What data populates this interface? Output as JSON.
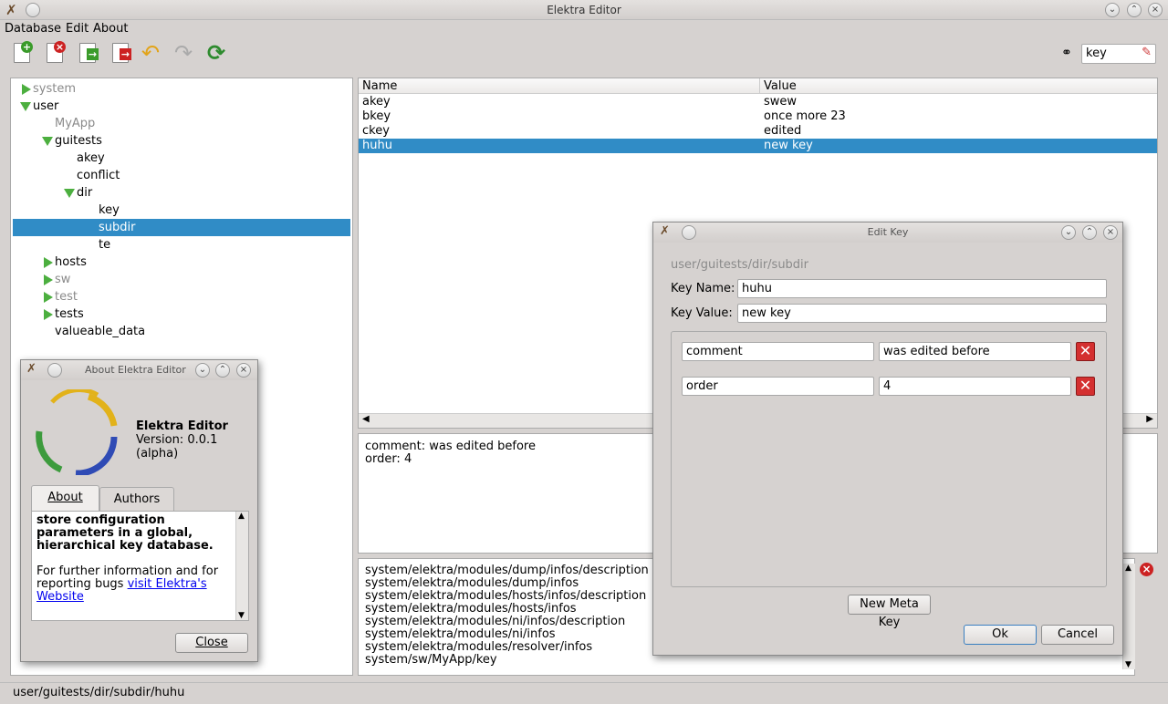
{
  "window": {
    "title": "Elektra Editor"
  },
  "menu": {
    "items": [
      "Database",
      "Edit",
      "About"
    ]
  },
  "search": {
    "value": "key"
  },
  "tree": {
    "items": [
      {
        "label": "system",
        "gray": true,
        "arrow": "right",
        "indent": 0
      },
      {
        "label": "user",
        "gray": false,
        "arrow": "down",
        "indent": 0
      },
      {
        "label": "MyApp",
        "gray": true,
        "arrow": "none",
        "indent": 1
      },
      {
        "label": "guitests",
        "gray": false,
        "arrow": "down",
        "indent": 1
      },
      {
        "label": "akey",
        "gray": false,
        "arrow": "none",
        "indent": 2
      },
      {
        "label": "conflict",
        "gray": false,
        "arrow": "none",
        "indent": 2
      },
      {
        "label": "dir",
        "gray": false,
        "arrow": "down",
        "indent": 2
      },
      {
        "label": "key",
        "gray": false,
        "arrow": "none",
        "indent": 3
      },
      {
        "label": "subdir",
        "gray": false,
        "arrow": "none",
        "indent": 3,
        "selected": true
      },
      {
        "label": "te",
        "gray": false,
        "arrow": "none",
        "indent": 3
      },
      {
        "label": "hosts",
        "gray": false,
        "arrow": "right",
        "indent": 1
      },
      {
        "label": "sw",
        "gray": true,
        "arrow": "right",
        "indent": 1
      },
      {
        "label": "test",
        "gray": true,
        "arrow": "right",
        "indent": 1
      },
      {
        "label": "tests",
        "gray": false,
        "arrow": "right",
        "indent": 1
      },
      {
        "label": "valueable_data",
        "gray": false,
        "arrow": "none",
        "indent": 1
      }
    ]
  },
  "table": {
    "headers": [
      "Name",
      "Value"
    ],
    "rows": [
      {
        "name": "akey",
        "value": "swew"
      },
      {
        "name": "bkey",
        "value": "once more 23"
      },
      {
        "name": "ckey",
        "value": "edited"
      },
      {
        "name": "huhu",
        "value": "new key",
        "selected": true
      }
    ]
  },
  "meta_pane": {
    "lines": [
      "comment: was edited before",
      "order: 4"
    ]
  },
  "search_results": {
    "lines": [
      "system/elektra/modules/dump/infos/description",
      "system/elektra/modules/dump/infos",
      "system/elektra/modules/hosts/infos/description",
      "system/elektra/modules/hosts/infos",
      "system/elektra/modules/ni/infos/description",
      "system/elektra/modules/ni/infos",
      "system/elektra/modules/resolver/infos",
      "system/sw/MyApp/key"
    ]
  },
  "status": {
    "path": "user/guitests/dir/subdir/huhu"
  },
  "edit_dialog": {
    "title": "Edit Key",
    "path": "user/guitests/dir/subdir",
    "key_name_label": "Key Name:",
    "key_name": "huhu",
    "key_value_label": "Key Value:",
    "key_value": "new key",
    "meta": [
      {
        "name": "comment",
        "value": "was edited before"
      },
      {
        "name": "order",
        "value": "4"
      }
    ],
    "new_meta_label": "New Meta Key",
    "ok_label": "Ok",
    "cancel_label": "Cancel"
  },
  "about_dialog": {
    "title": "About Elektra Editor",
    "app_name": "Elektra Editor",
    "version": "Version: 0.0.1 (alpha)",
    "tabs": [
      "About",
      "Authors"
    ],
    "bold_text": "store configuration parameters in a global, hierarchical key database.",
    "info_text": "For further information and for reporting bugs ",
    "link_text": "visit Elektra's Website",
    "close_label": "Close"
  },
  "colors": {
    "selection": "#308cc6",
    "tree_arrow": "#4caf3f",
    "delete": "#d43030"
  }
}
